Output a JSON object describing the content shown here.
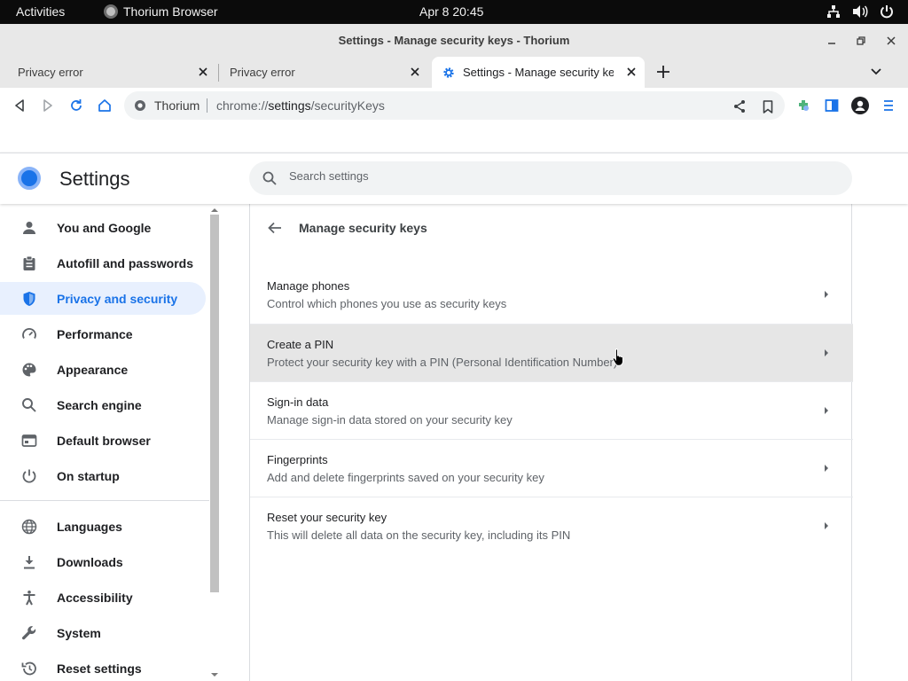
{
  "gnome": {
    "activities": "Activities",
    "app_name": "Thorium Browser",
    "clock": "Apr 8  20:45"
  },
  "window": {
    "title": "Settings - Manage security keys - Thorium"
  },
  "tabs": [
    {
      "label": "Privacy error"
    },
    {
      "label": "Privacy error"
    },
    {
      "label": "Settings - Manage security keys - Thorium"
    }
  ],
  "omnibox": {
    "site_label": "Thorium",
    "url_scheme": "chrome://",
    "url_host": "settings",
    "url_path": "/securityKeys"
  },
  "settings": {
    "title": "Settings",
    "search_placeholder": "Search settings"
  },
  "sidebar": {
    "items": [
      {
        "label": "You and Google",
        "icon": "person-icon"
      },
      {
        "label": "Autofill and passwords",
        "icon": "clipboard-icon"
      },
      {
        "label": "Privacy and security",
        "icon": "shield-icon",
        "active": true
      },
      {
        "label": "Performance",
        "icon": "speedometer-icon"
      },
      {
        "label": "Appearance",
        "icon": "palette-icon"
      },
      {
        "label": "Search engine",
        "icon": "search-icon"
      },
      {
        "label": "Default browser",
        "icon": "browser-window-icon"
      },
      {
        "label": "On startup",
        "icon": "power-icon"
      },
      {
        "label": "Languages",
        "icon": "globe-icon"
      },
      {
        "label": "Downloads",
        "icon": "download-icon"
      },
      {
        "label": "Accessibility",
        "icon": "accessibility-icon"
      },
      {
        "label": "System",
        "icon": "wrench-icon"
      },
      {
        "label": "Reset settings",
        "icon": "history-icon"
      }
    ]
  },
  "page": {
    "title": "Manage security keys",
    "rows": [
      {
        "title": "Manage phones",
        "subtitle": "Control which phones you use as security keys"
      },
      {
        "title": "Create a PIN",
        "subtitle": "Protect your security key with a PIN (Personal Identification Number)"
      },
      {
        "title": "Sign-in data",
        "subtitle": "Manage sign-in data stored on your security key"
      },
      {
        "title": "Fingerprints",
        "subtitle": "Add and delete fingerprints saved on your security key"
      },
      {
        "title": "Reset your security key",
        "subtitle": "This will delete all data on the security key, including its PIN"
      }
    ]
  },
  "colors": {
    "accent": "#1a73e8",
    "active_nav_bg": "#e8f0fe",
    "hover_row_bg": "#e6e6e6",
    "topbar_bg": "#0b0b0b"
  }
}
